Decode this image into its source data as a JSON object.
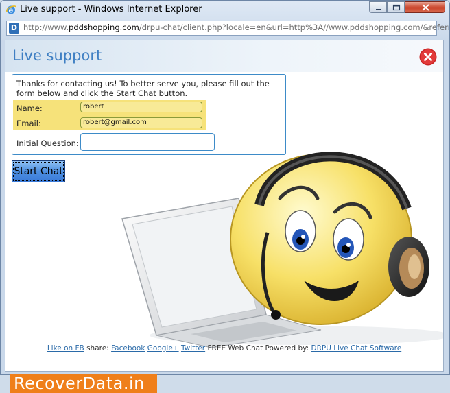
{
  "window": {
    "title": "Live support - Windows Internet Explorer"
  },
  "address_bar": {
    "url_prefix": "http://www.",
    "url_domain": "pddshopping.com",
    "url_rest": "/drpu-chat/client.php?locale=en&url=http%3A//www.pddshopping.com/&referr"
  },
  "page": {
    "title": "Live support",
    "intro": "Thanks for contacting us! To better serve you, please fill out the form below and click the Start Chat button.",
    "form": {
      "name_label": "Name:",
      "name_value": "robert",
      "email_label": "Email:",
      "email_value": "robert@gmail.com",
      "question_label": "Initial Question:",
      "question_value": ""
    },
    "start_button": "Start Chat"
  },
  "footer": {
    "like_link": "Like on FB",
    "share_text": " share: ",
    "facebook_link": "Facebook",
    "google_link": "Google+",
    "twitter_link": "Twitter",
    "powered_text": " FREE Web Chat Powered by: ",
    "drpu_link": "DRPU Live Chat Software"
  },
  "watermark": {
    "text": "RecoverData.in"
  },
  "colors": {
    "accent": "#3f7fc3",
    "highlight": "#f6e27a",
    "watermark_bg": "#ef7f1a"
  }
}
